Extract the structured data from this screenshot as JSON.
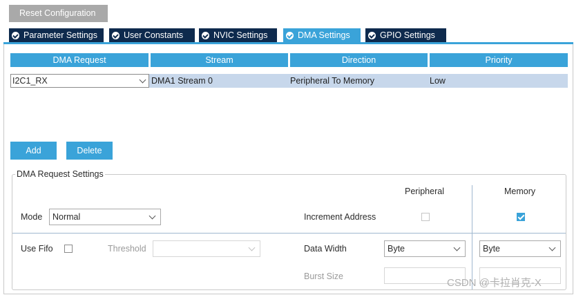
{
  "toolbar": {
    "reset_label": "Reset Configuration"
  },
  "tabs": [
    {
      "label": "Parameter Settings"
    },
    {
      "label": "User Constants"
    },
    {
      "label": "NVIC Settings"
    },
    {
      "label": "DMA Settings"
    },
    {
      "label": "GPIO Settings"
    }
  ],
  "table": {
    "headers": [
      "DMA Request",
      "Stream",
      "Direction",
      "Priority"
    ],
    "rows": [
      {
        "request": "I2C1_RX",
        "stream": "DMA1 Stream 0",
        "direction": "Peripheral To Memory",
        "priority": "Low"
      }
    ]
  },
  "actions": {
    "add_label": "Add",
    "delete_label": "Delete"
  },
  "settings": {
    "title": "DMA Request Settings",
    "peripheral_col": "Peripheral",
    "memory_col": "Memory",
    "mode_label": "Mode",
    "mode_value": "Normal",
    "increment_label": "Increment Address",
    "use_fifo_label": "Use Fifo",
    "threshold_label": "Threshold",
    "data_width_label": "Data Width",
    "peripheral_width": "Byte",
    "memory_width": "Byte",
    "burst_size_label": "Burst Size"
  },
  "watermark": "CSDN @卡拉肖克-X",
  "colors": {
    "accent": "#3aa3d9",
    "tab_dark": "#0e2a4d",
    "row_selected": "#c7d7eb"
  }
}
